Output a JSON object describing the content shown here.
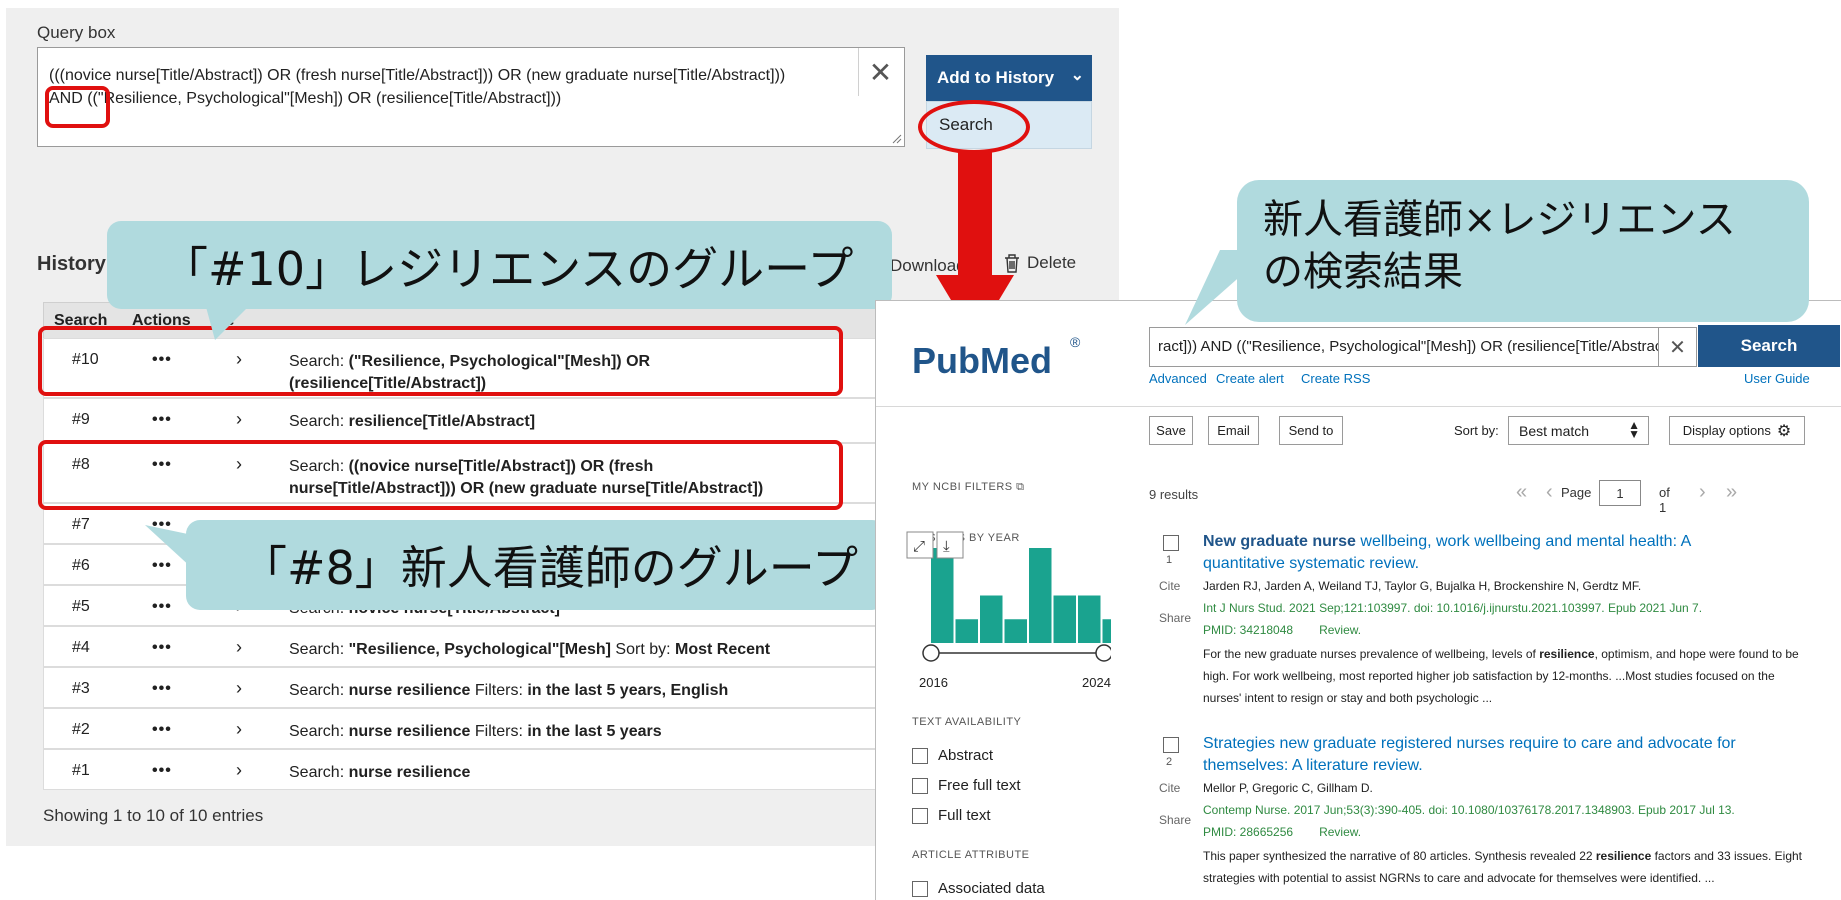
{
  "query_section": {
    "label": "Query box",
    "query_line1": "(((novice nurse[Title/Abstract]) OR (fresh nurse[Title/Abstract])) OR (new graduate nurse[Title/Abstract]))",
    "query_line2": "AND ((\"Resilience, Psychological\"[Mesh]) OR (resilience[Title/Abstract]))",
    "add_to_history": "Add to History",
    "search_option": "Search"
  },
  "history": {
    "title": "History",
    "download": "Download",
    "delete": "Delete",
    "columns": [
      "Search",
      "Actions",
      "De"
    ],
    "rows": [
      {
        "num": "#10",
        "prefix": "Search: ",
        "query": "(\"Resilience, Psychological\"[Mesh]) OR (resilience[Title/Abstract])",
        "filter_label": "",
        "filter_value": ""
      },
      {
        "num": "#9",
        "prefix": "Search: ",
        "query": "resilience[Title/Abstract]",
        "filter_label": "",
        "filter_value": ""
      },
      {
        "num": "#8",
        "prefix": "Search: ",
        "query": "((novice nurse[Title/Abstract]) OR (fresh nurse[Title/Abstract])) OR (new graduate nurse[Title/Abstract])",
        "filter_label": "",
        "filter_value": ""
      },
      {
        "num": "#7",
        "prefix": "",
        "query": "",
        "filter_label": "",
        "filter_value": ""
      },
      {
        "num": "#6",
        "prefix": "",
        "query": "",
        "filter_label": "",
        "filter_value": ""
      },
      {
        "num": "#5",
        "prefix": "Search: ",
        "query": "novice nurse[Title/Abstract]",
        "filter_label": "",
        "filter_value": ""
      },
      {
        "num": "#4",
        "prefix": "Search: ",
        "query": "\"Resilience, Psychological\"[Mesh]",
        "filter_label": " Sort by: ",
        "filter_value": "Most Recent"
      },
      {
        "num": "#3",
        "prefix": "Search: ",
        "query": "nurse resilience",
        "filter_label": " Filters: ",
        "filter_value": "in the last 5 years, English"
      },
      {
        "num": "#2",
        "prefix": "Search: ",
        "query": "nurse resilience",
        "filter_label": " Filters: ",
        "filter_value": "in the last 5 years"
      },
      {
        "num": "#1",
        "prefix": "Search: ",
        "query": "nurse resilience",
        "filter_label": "",
        "filter_value": ""
      }
    ],
    "dots": "•••",
    "showing": "Showing 1 to 10 of 10 entries"
  },
  "callouts": {
    "group10": "「#10」レジリエンスのグループ",
    "group8": "「#8」新人看護師のグループ",
    "result_line1": "新人看護師×レジリエンス",
    "result_line2": "の検索結果"
  },
  "pubmed": {
    "logo_text": "PubMed",
    "registered": "®",
    "search_value": "ract])) AND ((\"Resilience, Psychological\"[Mesh]) OR (resilience[Title/Abstract]))",
    "search_button": "Search",
    "links": {
      "advanced": "Advanced",
      "create_alert": "Create alert",
      "create_rss": "Create RSS",
      "user_guide": "User Guide"
    },
    "toolbar": {
      "save": "Save",
      "email": "Email",
      "send_to": "Send to",
      "sort_by": "Sort by:",
      "sort_value": "Best match",
      "display_options": "Display options"
    },
    "sidebar": {
      "my_ncbi_filters": "MY NCBI FILTERS",
      "results_by_year": "RESULTS BY YEAR",
      "year_start": "2016",
      "year_end": "2024",
      "text_availability": "TEXT AVAILABILITY",
      "abstract": "Abstract",
      "free_full_text": "Free full text",
      "full_text": "Full text",
      "article_attribute": "ARTICLE ATTRIBUTE",
      "associated_data": "Associated data",
      "year_counts": [
        4,
        1,
        2,
        1,
        4,
        2,
        2,
        1,
        0
      ]
    },
    "results_count": "9 results",
    "pager": {
      "page_label": "Page",
      "page_value": "1",
      "of": "of 1"
    },
    "articles": [
      {
        "num": "1",
        "cite": "Cite",
        "share": "Share",
        "title_bold": "New graduate nurse",
        "title_rest": " wellbeing, work wellbeing and mental health: A quantitative systematic review.",
        "authors": "Jarden RJ, Jarden A, Weiland TJ, Taylor G, Bujalka H, Brockenshire N, Gerdtz MF.",
        "journal": "Int J Nurs Stud. 2021 Sep;121:103997. doi: 10.1016/j.ijnurstu.2021.103997. Epub 2021 Jun 7.",
        "pmid": "PMID: 34218048",
        "type": "Review.",
        "snippet_a": "For the new graduate nurses prevalence of wellbeing, levels of ",
        "snippet_bold": "resilience",
        "snippet_b": ", optimism, and hope were found to be high. For work wellbeing, most reported higher job satisfaction by 12-months. ...Most studies focused on the nurses' intent to resign or stay and both psychologic ..."
      },
      {
        "num": "2",
        "cite": "Cite",
        "share": "Share",
        "title_bold": "",
        "title_rest": "Strategies new graduate registered nurses require to care and advocate for themselves: A literature review.",
        "authors": "Mellor P, Gregoric C, Gillham D.",
        "journal": "Contemp Nurse. 2017 Jun;53(3):390-405. doi: 10.1080/10376178.2017.1348903. Epub 2017 Jul 13.",
        "pmid": "PMID: 28665256",
        "type": "Review.",
        "snippet_a": "This paper synthesized the narrative of 80 articles. Synthesis revealed 22 ",
        "snippet_bold": "resilience",
        "snippet_b": " factors and 33 issues. Eight strategies with potential to assist NGRNs to care and advocate for themselves were identified. ..."
      }
    ]
  },
  "colors": {
    "accent": "#20558a",
    "link": "#0071bc",
    "journal": "#2f8a41",
    "annotation": "#e0100f",
    "callout": "#b0dade",
    "bar": "#1aa38f"
  }
}
